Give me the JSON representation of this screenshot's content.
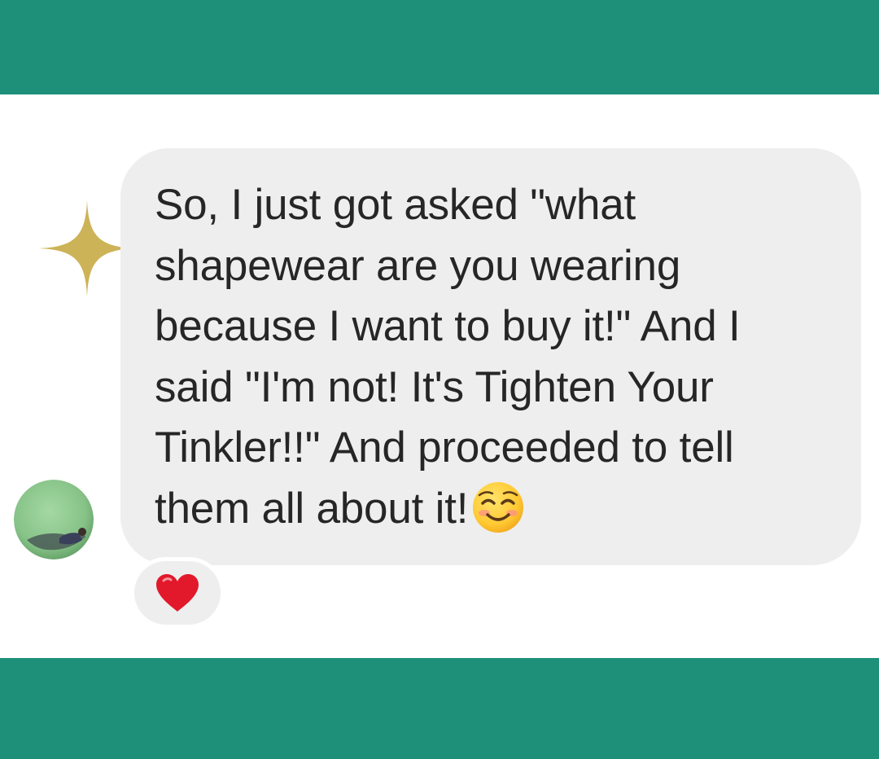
{
  "theme": {
    "band_color": "#1E907A",
    "background": "#FFFFFF",
    "bubble_color": "#EEEEEE",
    "text_color": "#262626",
    "sparkle_color": "#CDB358",
    "avatar_color": "#8FCB90",
    "heart_color": "#E2182B"
  },
  "message": {
    "text": "So, I just got asked \"what\nshapewear are you wearing\nbecause I want to buy it!\" And I\nsaid \"I'm not! It's Tighten Your\nTinkler!!\" And proceeded to tell\nthem all about it!",
    "trailing_emoji": "smiling-face-with-blushing-eyes-icon"
  },
  "sender": {
    "avatar_icon": "avatar"
  },
  "reaction": {
    "icon": "red-heart-icon"
  },
  "decoration": {
    "icon": "sparkle-icon"
  }
}
